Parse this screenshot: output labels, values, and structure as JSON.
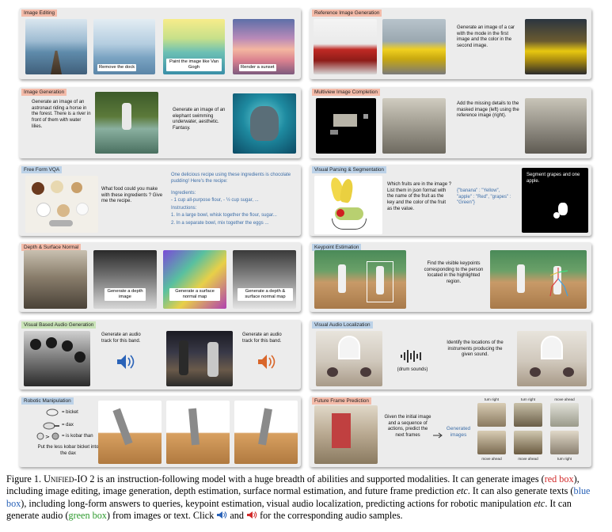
{
  "panels": {
    "image_editing": {
      "tag": "Image Editing",
      "captions": [
        "Remove the dock",
        "Paint the image like Van Gogh",
        "Render a sunset"
      ]
    },
    "reference_image": {
      "tag": "Reference Image Generation",
      "text": "Generate an image of a car with the mode in the first image and the color in the second image."
    },
    "image_generation": {
      "tag": "Image Generation",
      "text1": "Generate an image of an astronaut riding a horse in the forest. There is a river in front of them with water lilies.",
      "text2": "Generate an image of an elephant swimming underwater, aesthetic. Fantasy."
    },
    "multiview": {
      "tag": "Multiview Image Completion",
      "text": "Add the missing details to the masked image (left) using the reference image (right)."
    },
    "vqa": {
      "tag": "Free Form VQA",
      "question": "What food could you make with these ingredients ? Give me the recipe.",
      "answer_lines": [
        "One delicious recipe using these ingredients is chocolate pudding! Here's the recipe:",
        "Ingredients:",
        "- 1 cup all-purpose flour, - ½ cup sugar, ...",
        "Instructions:",
        "1. In a large bowl, whisk together the flour, sugar...",
        "2. In a separate bowl, mix together the eggs ..."
      ]
    },
    "visual_parsing": {
      "tag": "Visual Parsing & Segmentation",
      "question": "Which fruits are in the image ? List them in json format with the name of the fruit as the key and the color of the fruit as the value.",
      "answer": "{\"banana\" : \"Yellow\", \"apple\" : \"Red\", \"grapes\" : \"Green\"}",
      "seg_text": "Segment grapes and one apple."
    },
    "depth": {
      "tag": "Depth & Surface Normal",
      "captions": [
        "Generate a depth image",
        "Generate a surface normal map",
        "Generate a depth & surface normal map"
      ]
    },
    "keypoint": {
      "tag": "Keypoint Estimation",
      "text": "Find the visible keypoints corresponding to the person located in the highlighted region."
    },
    "audio_gen": {
      "tag": "Visual Based Audio Generation",
      "text1": "Generate an audio track for this band.",
      "text2": "Generate an audio track for this band."
    },
    "audio_loc": {
      "tag": "Visual Audio Localization",
      "drum_label": "(drum sounds)",
      "text": "Identify the locations of the instruments producing the given sound."
    },
    "robotic": {
      "tag": "Robotic Manipulation",
      "legend": [
        "= bicket",
        "= dax",
        "= is kobar than",
        "Put the less kobar bicket into the dax"
      ]
    },
    "future": {
      "tag": "Future Frame Prediction",
      "text": "Given the initial image and a sequence of actions, predict the next frames",
      "gen_label": "Generated images",
      "actions_top": [
        "turn right",
        "turn right",
        "move ahead"
      ],
      "actions_bottom": [
        "move ahead",
        "move ahead",
        "turn right"
      ]
    }
  },
  "caption": {
    "fig": "Figure 1.",
    "name": "Unified-IO 2",
    "p1": "is an instruction-following model with a huge breadth of abilities and supported modalities. It can generate images (",
    "red": "red box",
    "p2": "), including image editing, image generation, depth estimation, surface normal estimation, and future frame prediction",
    "etc": "etc",
    "p3": ". It can also generate texts (",
    "blue": "blue box",
    "p4": "), including long-form answers to queries, keypoint estimation, visual audio localization, predicting actions for robotic manipulation",
    "p5": ". It can generate audio (",
    "green": "green box",
    "p6": ") from images or text. Click",
    "p7": "and",
    "p8": "for the corresponding audio samples."
  },
  "colors": {
    "red_tag": "#f4bba9",
    "blue_tag": "#bcd2e8",
    "green_tag": "#c9e3b8",
    "link_blue": "#2a63b8",
    "link_red": "#d12a2a",
    "link_green": "#2d9a2d"
  }
}
